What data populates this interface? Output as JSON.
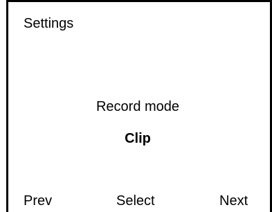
{
  "screen": {
    "title": "Settings",
    "setting_label": "Record mode",
    "setting_value": "Clip"
  },
  "softkeys": {
    "prev_label": "Prev",
    "select_label": "Select",
    "next_label": "Next"
  },
  "colors": {
    "background": "#ffffff",
    "foreground": "#000000"
  }
}
